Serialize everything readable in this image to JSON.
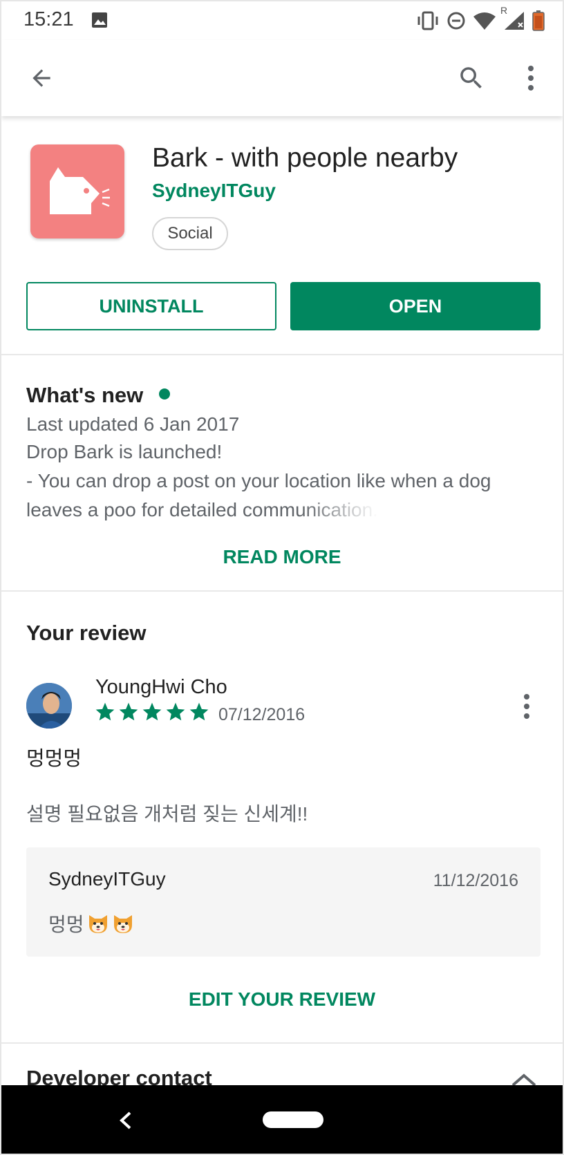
{
  "status_bar": {
    "time": "15:21",
    "icons": [
      "photo-icon",
      "vibrate-icon",
      "do-not-disturb-icon",
      "wifi-icon",
      "signal-roaming-icon",
      "battery-icon"
    ],
    "roaming_label": "R"
  },
  "toolbar": {
    "back_icon": "arrow-back-icon",
    "search_icon": "search-icon",
    "more_icon": "more-vert-icon"
  },
  "app": {
    "title": "Bark - with people nearby",
    "developer": "SydneyITGuy",
    "category": "Social",
    "icon_color": "#f38181",
    "uninstall_label": "UNINSTALL",
    "open_label": "OPEN"
  },
  "whats_new": {
    "title": "What's new",
    "updated": "Last updated 6 Jan 2017",
    "line1": "Drop Bark is launched!",
    "line2": "- You can drop a post on your location like when a dog",
    "line3": "leaves a poo for detailed communication.",
    "read_more": "READ MORE"
  },
  "your_review": {
    "title": "Your review",
    "reviewer": "YoungHwi Cho",
    "rating": 5,
    "date": "07/12/2016",
    "review_title": "멍멍멍",
    "review_body": "설명 필요없음 개처럼 짖는 신세계!!",
    "reply": {
      "developer": "SydneyITGuy",
      "date": "11/12/2016",
      "text": "멍멍"
    },
    "edit_label": "EDIT YOUR REVIEW"
  },
  "developer_contact": {
    "title": "Developer contact"
  },
  "colors": {
    "accent": "#01875f",
    "star": "#01875f",
    "nav_bar": "#000000"
  }
}
